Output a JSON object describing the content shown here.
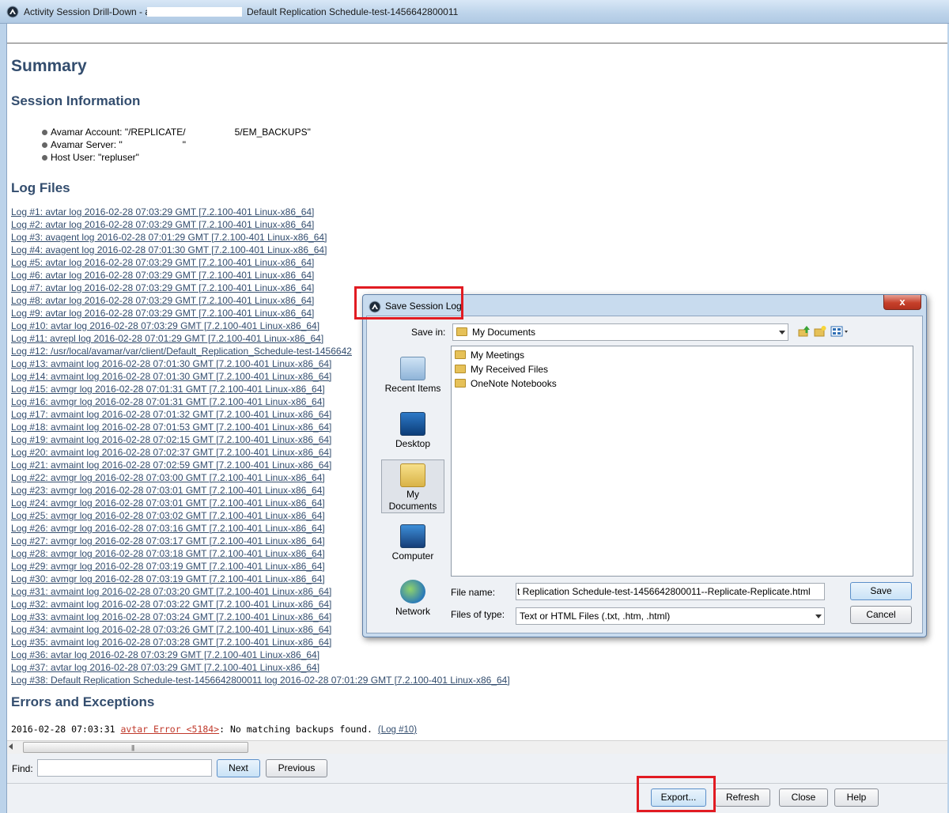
{
  "window": {
    "title_prefix": "Activity Session Drill-Down - a",
    "title_suffix": "Default Replication Schedule-test-1456642800011"
  },
  "report": {
    "summary_heading": "Summary",
    "session_heading": "Session Information",
    "session_items": [
      {
        "part1": "Avamar Account: \"/REPLICATE/",
        "part2": "5/EM_BACKUPS\""
      },
      {
        "part1": "Avamar Server: \"",
        "part2": "\""
      },
      {
        "part1": "Host User: \"repluser\"",
        "part2": ""
      }
    ],
    "logs_heading": "Log Files",
    "logs": [
      "Log #1: avtar log 2016-02-28 07:03:29 GMT [7.2.100-401 Linux-x86_64]",
      "Log #2: avtar log 2016-02-28 07:03:29 GMT [7.2.100-401 Linux-x86_64]",
      "Log #3: avagent log 2016-02-28 07:01:29 GMT [7.2.100-401 Linux-x86_64]",
      "Log #4: avagent log 2016-02-28 07:01:30 GMT [7.2.100-401 Linux-x86_64]",
      "Log #5: avtar log 2016-02-28 07:03:29 GMT [7.2.100-401 Linux-x86_64]",
      "Log #6: avtar log 2016-02-28 07:03:29 GMT [7.2.100-401 Linux-x86_64]",
      "Log #7: avtar log 2016-02-28 07:03:29 GMT [7.2.100-401 Linux-x86_64]",
      "Log #8: avtar log 2016-02-28 07:03:29 GMT [7.2.100-401 Linux-x86_64]",
      "Log #9: avtar log 2016-02-28 07:03:29 GMT [7.2.100-401 Linux-x86_64]",
      "Log #10: avtar log 2016-02-28 07:03:29 GMT [7.2.100-401 Linux-x86_64]",
      "Log #11: avrepl log 2016-02-28 07:01:29 GMT [7.2.100-401 Linux-x86_64]",
      "Log #12: /usr/local/avamar/var/client/Default_Replication_Schedule-test-1456642",
      "Log #13: avmaint log 2016-02-28 07:01:30 GMT [7.2.100-401 Linux-x86_64]",
      "Log #14: avmaint log 2016-02-28 07:01:30 GMT [7.2.100-401 Linux-x86_64]",
      "Log #15: avmgr log 2016-02-28 07:01:31 GMT [7.2.100-401 Linux-x86_64]",
      "Log #16: avmgr log 2016-02-28 07:01:31 GMT [7.2.100-401 Linux-x86_64]",
      "Log #17: avmaint log 2016-02-28 07:01:32 GMT [7.2.100-401 Linux-x86_64]",
      "Log #18: avmaint log 2016-02-28 07:01:53 GMT [7.2.100-401 Linux-x86_64]",
      "Log #19: avmaint log 2016-02-28 07:02:15 GMT [7.2.100-401 Linux-x86_64]",
      "Log #20: avmaint log 2016-02-28 07:02:37 GMT [7.2.100-401 Linux-x86_64]",
      "Log #21: avmaint log 2016-02-28 07:02:59 GMT [7.2.100-401 Linux-x86_64]",
      "Log #22: avmgr log 2016-02-28 07:03:00 GMT [7.2.100-401 Linux-x86_64]",
      "Log #23: avmgr log 2016-02-28 07:03:01 GMT [7.2.100-401 Linux-x86_64]",
      "Log #24: avmgr log 2016-02-28 07:03:01 GMT [7.2.100-401 Linux-x86_64]",
      "Log #25: avmgr log 2016-02-28 07:03:02 GMT [7.2.100-401 Linux-x86_64]",
      "Log #26: avmgr log 2016-02-28 07:03:16 GMT [7.2.100-401 Linux-x86_64]",
      "Log #27: avmgr log 2016-02-28 07:03:17 GMT [7.2.100-401 Linux-x86_64]",
      "Log #28: avmgr log 2016-02-28 07:03:18 GMT [7.2.100-401 Linux-x86_64]",
      "Log #29: avmgr log 2016-02-28 07:03:19 GMT [7.2.100-401 Linux-x86_64]",
      "Log #30: avmgr log 2016-02-28 07:03:19 GMT [7.2.100-401 Linux-x86_64]",
      "Log #31: avmaint log 2016-02-28 07:03:20 GMT [7.2.100-401 Linux-x86_64]",
      "Log #32: avmaint log 2016-02-28 07:03:22 GMT [7.2.100-401 Linux-x86_64]",
      "Log #33: avmaint log 2016-02-28 07:03:24 GMT [7.2.100-401 Linux-x86_64]",
      "Log #34: avmaint log 2016-02-28 07:03:26 GMT [7.2.100-401 Linux-x86_64]",
      "Log #35: avmaint log 2016-02-28 07:03:28 GMT [7.2.100-401 Linux-x86_64]",
      "Log #36: avtar log 2016-02-28 07:03:29 GMT [7.2.100-401 Linux-x86_64]",
      "Log #37: avtar log 2016-02-28 07:03:29 GMT [7.2.100-401 Linux-x86_64]",
      "Log #38: Default Replication Schedule-test-1456642800011 log 2016-02-28 07:01:29 GMT [7.2.100-401 Linux-x86_64]"
    ],
    "errors_heading": "Errors and Exceptions",
    "error": {
      "timestamp": "2016-02-28 07:03:31 ",
      "link": "avtar Error <5184>",
      "message": ": No matching backups found. ",
      "log_ref": "(Log #10)"
    }
  },
  "findbar": {
    "label": "Find:",
    "value": "",
    "next": "Next",
    "previous": "Previous"
  },
  "footer": {
    "export": "Export...",
    "refresh": "Refresh",
    "close": "Close",
    "help": "Help"
  },
  "dialog": {
    "title": "Save Session Log",
    "close_symbol": "x",
    "save_in_label": "Save in:",
    "save_in_value": "My Documents",
    "places": [
      "Recent Items",
      "Desktop",
      "My Documents",
      "Computer",
      "Network"
    ],
    "files": [
      "My Meetings",
      "My Received Files",
      "OneNote Notebooks"
    ],
    "file_name_label": "File name:",
    "file_name_value": "t Replication Schedule-test-1456642800011--Replicate-Replicate.html",
    "file_type_label": "Files of type:",
    "file_type_value": "Text or HTML Files (.txt, .htm, .html)",
    "save": "Save",
    "cancel": "Cancel"
  },
  "colors": {
    "heading": "#334d6e",
    "highlight_box": "#e11b22",
    "error_link": "#c0392b"
  }
}
